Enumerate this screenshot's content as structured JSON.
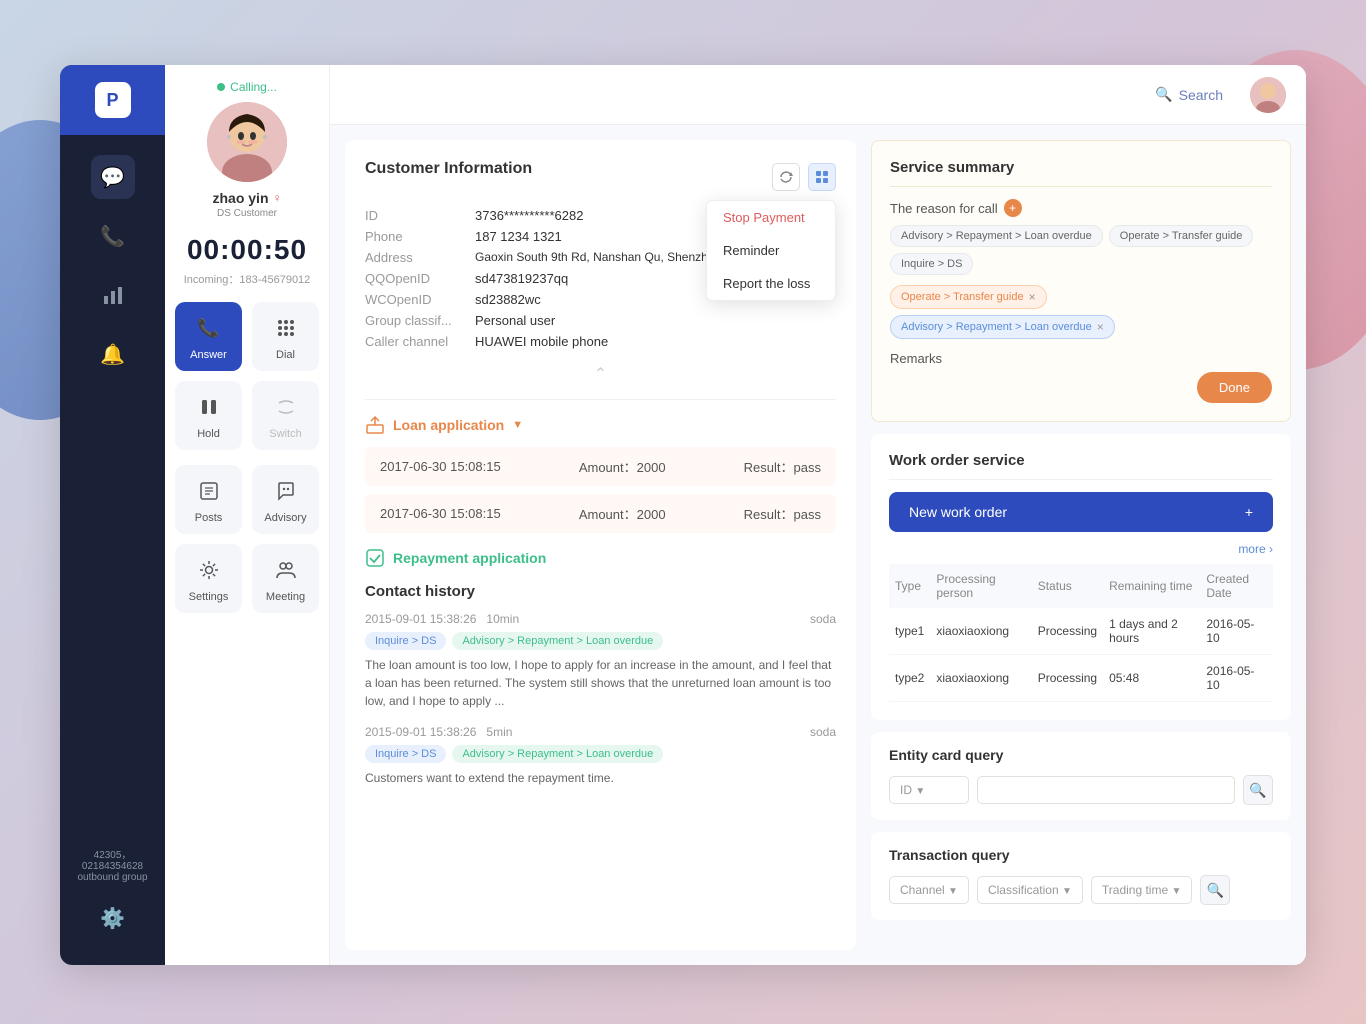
{
  "app": {
    "logo_text": "P"
  },
  "header": {
    "search_label": "Search",
    "search_icon": "🔍"
  },
  "sidebar": {
    "nav_items": [
      {
        "id": "chat",
        "icon": "💬",
        "label": "Chat"
      },
      {
        "id": "phone",
        "icon": "📞",
        "label": "Phone"
      },
      {
        "id": "stats",
        "icon": "📊",
        "label": "Stats"
      },
      {
        "id": "bell",
        "icon": "🔔",
        "label": "Notifications"
      }
    ],
    "bottom_actions": [
      {
        "id": "settings",
        "icon": "⚙️",
        "label": "Settings"
      }
    ],
    "outbound_info": "42305，02184354628",
    "outbound_group": "outbound group"
  },
  "caller_panel": {
    "status": "Calling...",
    "name": "zhao yin",
    "type": "DS Customer",
    "timer": "00:00:50",
    "incoming": "Incoming：183-45679012",
    "actions": [
      {
        "id": "answer",
        "icon": "📞",
        "label": "Answer",
        "type": "answer"
      },
      {
        "id": "dial",
        "icon": "⠿",
        "label": "Dial",
        "type": "secondary"
      },
      {
        "id": "hold",
        "icon": "⏸",
        "label": "Hold",
        "type": "secondary"
      },
      {
        "id": "switch",
        "icon": "📞",
        "label": "Switch",
        "type": "disabled"
      },
      {
        "id": "posts",
        "icon": "📋",
        "label": "Posts",
        "type": "secondary"
      },
      {
        "id": "advisory",
        "icon": "💬",
        "label": "Advisory",
        "type": "secondary"
      },
      {
        "id": "settings-action",
        "icon": "⚙️",
        "label": "Settings",
        "type": "secondary"
      },
      {
        "id": "meeting",
        "icon": "👥",
        "label": "Meeting",
        "type": "secondary"
      }
    ]
  },
  "customer_info": {
    "panel_title": "Customer Information",
    "fields": [
      {
        "label": "ID",
        "value": "3736**********6282"
      },
      {
        "label": "Phone",
        "value": "187 1234 1321"
      },
      {
        "label": "Address",
        "value": "Gaoxin South 9th Rd, Nanshan Qu, Shenzhen, Guangdong"
      },
      {
        "label": "QQOpenID",
        "value": "sd473819237qq"
      },
      {
        "label": "WCOpenID",
        "value": "sd23882wc"
      },
      {
        "label": "Group classif...",
        "value": "Personal user"
      },
      {
        "label": "Caller channel",
        "value": "HUAWEI mobile phone"
      }
    ],
    "dropdown_menu": [
      {
        "id": "stop-payment",
        "label": "Stop Payment",
        "type": "red"
      },
      {
        "id": "reminder",
        "label": "Reminder",
        "type": "normal"
      },
      {
        "id": "report-loss",
        "label": "Report the loss",
        "type": "normal"
      }
    ],
    "loan_section": {
      "title": "Loan application",
      "entries": [
        {
          "date": "2017-06-30 15:08:15",
          "amount_label": "Amount：",
          "amount": "2000",
          "result_label": "Result：",
          "result": "pass"
        },
        {
          "date": "2017-06-30 15:08:15",
          "amount_label": "Amount：",
          "amount": "2000",
          "result_label": "Result：",
          "result": "pass"
        }
      ]
    },
    "repayment": {
      "title": "Repayment application"
    },
    "contact_history": {
      "title": "Contact history",
      "entries": [
        {
          "timestamp": "2015-09-01 15:38:26",
          "duration": "10min",
          "agent": "soda",
          "tags": [
            {
              "text": "Inquire > DS",
              "type": "blue"
            },
            {
              "text": "Advisory > Repayment > Loan overdue",
              "type": "green"
            }
          ],
          "text": "The loan amount is too low, I hope to apply for an increase in the amount, and I feel that a loan has been returned. The system still shows that the unreturned loan amount is too low, and I hope to apply ..."
        },
        {
          "timestamp": "2015-09-01 15:38:26",
          "duration": "5min",
          "agent": "soda",
          "tags": [
            {
              "text": "Inquire > DS",
              "type": "blue"
            },
            {
              "text": "Advisory > Repayment > Loan overdue",
              "type": "green"
            }
          ],
          "text": "Customers want to extend the repayment time."
        }
      ]
    }
  },
  "service_summary": {
    "title": "Service summary",
    "reason_label": "The reason for call",
    "chips": [
      {
        "text": "Advisory > Repayment > Loan overdue"
      },
      {
        "text": "Operate > Transfer guide"
      },
      {
        "text": "Inquire > DS"
      }
    ],
    "selected_tags": [
      {
        "text": "Operate > Transfer guide",
        "type": "orange"
      },
      {
        "text": "Advisory > Repayment > Loan overdue",
        "type": "blue"
      }
    ],
    "remarks_label": "Remarks",
    "done_label": "Done"
  },
  "work_order": {
    "title": "Work order service",
    "new_btn_label": "New work order",
    "more_label": "more",
    "table_headers": [
      "Type",
      "Processing person",
      "Status",
      "Remaining time",
      "Created Date"
    ],
    "table_rows": [
      {
        "type": "type1",
        "person": "xiaoxiaoxiong",
        "status": "Processing",
        "remaining": "1 days and 2 hours",
        "date": "2016-05-10"
      },
      {
        "type": "type2",
        "person": "xiaoxiaoxiong",
        "status": "Processing",
        "remaining": "05:48",
        "date": "2016-05-10"
      }
    ]
  },
  "entity_card": {
    "title": "Entity card query",
    "select_placeholder": "ID",
    "search_icon": "🔍"
  },
  "transaction_query": {
    "title": "Transaction query",
    "dropdowns": [
      {
        "placeholder": "Channel"
      },
      {
        "placeholder": "Classification"
      },
      {
        "placeholder": "Trading time"
      }
    ],
    "search_icon": "🔍"
  }
}
